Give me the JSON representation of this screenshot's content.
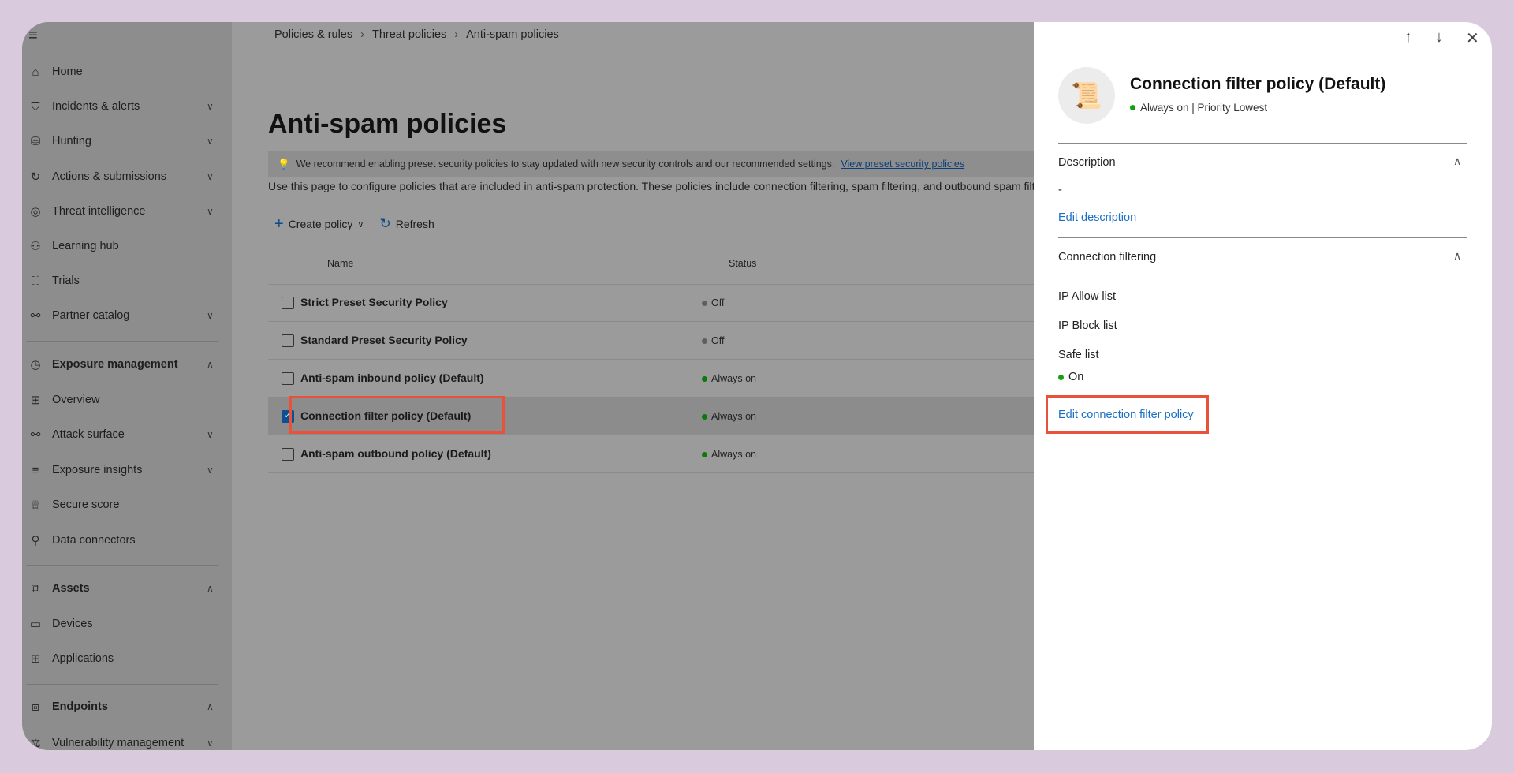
{
  "sidebar": {
    "items": [
      {
        "label": "Home",
        "icon": "home-icon",
        "glyph": "⌂",
        "chevron": ""
      },
      {
        "label": "Incidents & alerts",
        "icon": "shield-icon",
        "glyph": "⛉",
        "chevron": "∨"
      },
      {
        "label": "Hunting",
        "icon": "hunting-icon",
        "glyph": "⛁",
        "chevron": "∨"
      },
      {
        "label": "Actions & submissions",
        "icon": "actions-icon",
        "glyph": "↻",
        "chevron": "∨"
      },
      {
        "label": "Threat intelligence",
        "icon": "threat-intel-icon",
        "glyph": "◎",
        "chevron": "∨"
      },
      {
        "label": "Learning hub",
        "icon": "learning-icon",
        "glyph": "⚇",
        "chevron": ""
      },
      {
        "label": "Trials",
        "icon": "trials-icon",
        "glyph": "⛶",
        "chevron": ""
      },
      {
        "label": "Partner catalog",
        "icon": "partner-icon",
        "glyph": "⚯",
        "chevron": "∨"
      },
      {
        "label": "Exposure management",
        "icon": "exposure-icon",
        "glyph": "◷",
        "chevron": "∧",
        "bold": true
      },
      {
        "label": "Overview",
        "icon": "overview-icon",
        "glyph": "⊞",
        "chevron": ""
      },
      {
        "label": "Attack surface",
        "icon": "attack-surface-icon",
        "glyph": "⚯",
        "chevron": "∨"
      },
      {
        "label": "Exposure insights",
        "icon": "list-icon",
        "glyph": "≡",
        "chevron": "∨"
      },
      {
        "label": "Secure score",
        "icon": "trophy-icon",
        "glyph": "♕",
        "chevron": ""
      },
      {
        "label": "Data connectors",
        "icon": "connector-icon",
        "glyph": "⚲",
        "chevron": ""
      },
      {
        "label": "Assets",
        "icon": "assets-icon",
        "glyph": "⧉",
        "chevron": "∧",
        "bold": true
      },
      {
        "label": "Devices",
        "icon": "laptop-icon",
        "glyph": "▭",
        "chevron": ""
      },
      {
        "label": "Applications",
        "icon": "applications-icon",
        "glyph": "⊞",
        "chevron": ""
      },
      {
        "label": "Endpoints",
        "icon": "endpoints-icon",
        "glyph": "⧈",
        "chevron": "∧",
        "bold": true
      },
      {
        "label": "Vulnerability management",
        "icon": "vulnerability-icon",
        "glyph": "⚖",
        "chevron": "∨"
      }
    ]
  },
  "breadcrumb": [
    "Policies & rules",
    "Threat policies",
    "Anti-spam policies"
  ],
  "page": {
    "title": "Anti-spam policies",
    "banner_text": "We recommend enabling preset security policies to stay updated with new security controls and our recommended settings.",
    "banner_link": "View preset security policies",
    "description": "Use this page to configure policies that are included in anti-spam protection. These policies include connection filtering, spam filtering, and outbound spam filter",
    "create_policy": "Create policy",
    "refresh": "Refresh"
  },
  "table": {
    "columns": [
      "Name",
      "Status"
    ],
    "rows": [
      {
        "name": "Strict Preset Security Policy",
        "status": "Off",
        "status_color": "#5f5f5f",
        "checked": false
      },
      {
        "name": "Standard Preset Security Policy",
        "status": "Off",
        "status_color": "#5f5f5f",
        "checked": false
      },
      {
        "name": "Anti-spam inbound policy (Default)",
        "status": "Always on",
        "status_color": "#0b7a0b",
        "checked": false
      },
      {
        "name": "Connection filter policy (Default)",
        "status": "Always on",
        "status_color": "#0b7a0b",
        "checked": true
      },
      {
        "name": "Anti-spam outbound policy (Default)",
        "status": "Always on",
        "status_color": "#0b7a0b",
        "checked": false
      }
    ]
  },
  "panel": {
    "title": "Connection filter policy (Default)",
    "subtitle": "Always on | Priority Lowest",
    "description_header": "Description",
    "description_value": "-",
    "edit_description": "Edit description",
    "filtering_header": "Connection filtering",
    "ip_allow": "IP Allow list",
    "ip_block": "IP Block list",
    "safe_list": "Safe list",
    "safe_list_value": "On",
    "edit_link": "Edit connection filter policy"
  },
  "colors": {
    "accent": "#1a6fc4",
    "highlight": "#e9513a",
    "on": "#13a10e"
  }
}
